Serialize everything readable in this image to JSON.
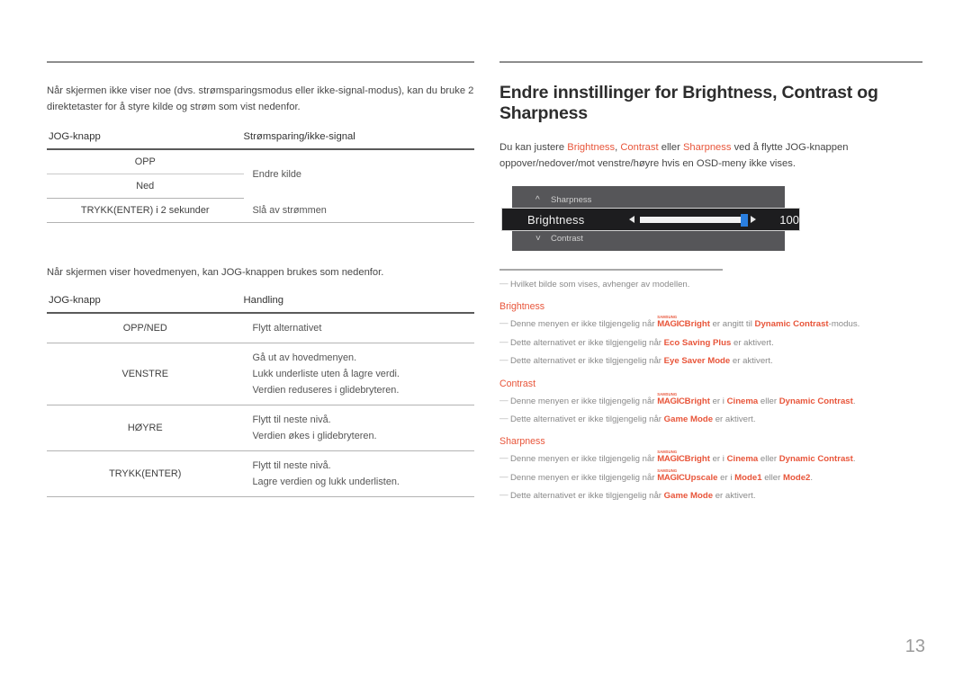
{
  "left": {
    "intro_paragraph": "Når skjermen ikke viser noe (dvs. strømsparingsmodus eller ikke-signal-modus), kan du bruke 2 direktetaster for å styre kilde og strøm som vist nedenfor.",
    "table1": {
      "headers": [
        "JOG-knapp",
        "Strømsparing/ikke-signal"
      ],
      "rows": [
        {
          "key": "OPP",
          "value": "Endre kilde"
        },
        {
          "key": "Ned",
          "value": ""
        },
        {
          "key": "TRYKK(ENTER) i 2 sekunder",
          "value": "Slå av strømmen"
        }
      ]
    },
    "intro_paragraph_2": "Når skjermen viser hovedmenyen, kan JOG-knappen brukes som nedenfor.",
    "table2": {
      "headers": [
        "JOG-knapp",
        "Handling"
      ],
      "rows": [
        {
          "key": "OPP/NED",
          "lines": [
            "Flytt alternativet"
          ]
        },
        {
          "key": "VENSTRE",
          "lines": [
            "Gå ut av hovedmenyen.",
            "Lukk underliste uten å lagre verdi.",
            "Verdien reduseres i glidebryteren."
          ]
        },
        {
          "key": "HØYRE",
          "lines": [
            "Flytt til neste nivå.",
            "Verdien økes i glidebryteren."
          ]
        },
        {
          "key": "TRYKK(ENTER)",
          "lines": [
            "Flytt til neste nivå.",
            "Lagre verdien og lukk underlisten."
          ]
        }
      ]
    }
  },
  "right": {
    "section_title": "Endre innstillinger for Brightness, Contrast og Sharpness",
    "intro": {
      "part1": "Du kan justere ",
      "term1": "Brightness",
      "sep1": ", ",
      "term2": "Contrast",
      "sep2": " eller ",
      "term3": "Sharpness",
      "part2": " ved å flytte JOG-knappen oppover/nedover/mot venstre/høyre hvis en OSD-meny ikke vises."
    },
    "osd": {
      "top_item": "Sharpness",
      "top_chevron": "chevron-up-icon",
      "active_item": "Brightness",
      "value": "100",
      "bottom_item": "Contrast",
      "bottom_chevron": "chevron-down-icon",
      "thumb_color": "#2a7fe0",
      "panel_color": "#565659",
      "active_row_color": "#1d1d1f"
    },
    "notes": {
      "dash": "—",
      "model_note": "Hvilket bilde som vises, avhenger av modellen.",
      "brightness": {
        "heading": "Brightness",
        "items": [
          {
            "pre": "Denne menyen er ikke tilgjengelig når ",
            "magic_sup": "SAMSUNG",
            "magic": "MAGIC",
            "magic_suffix": "Bright",
            "mid": " er angitt til ",
            "term": "Dynamic Contrast",
            "post": "-modus."
          },
          {
            "pre": "Dette alternativet er ikke tilgjengelig når ",
            "term": "Eco Saving Plus",
            "post": " er aktivert."
          },
          {
            "pre": "Dette alternativet er ikke tilgjengelig når ",
            "term": "Eye Saver Mode",
            "post": " er aktivert."
          }
        ]
      },
      "contrast": {
        "heading": "Contrast",
        "items": [
          {
            "pre": "Denne menyen er ikke tilgjengelig når ",
            "magic_sup": "SAMSUNG",
            "magic": "MAGIC",
            "magic_suffix": "Bright",
            "mid": " er i ",
            "term": "Cinema",
            "mid2": " eller ",
            "term2": "Dynamic Contrast",
            "post": "."
          },
          {
            "pre": "Dette alternativet er ikke tilgjengelig når ",
            "term": "Game Mode",
            "post": " er aktivert."
          }
        ]
      },
      "sharpness": {
        "heading": "Sharpness",
        "items": [
          {
            "pre": "Denne menyen er ikke tilgjengelig når ",
            "magic_sup": "SAMSUNG",
            "magic": "MAGIC",
            "magic_suffix": "Bright",
            "mid": " er i ",
            "term": "Cinema",
            "mid2": " eller ",
            "term2": "Dynamic Contrast",
            "post": "."
          },
          {
            "pre": "Denne menyen er ikke tilgjengelig når ",
            "magic_sup": "SAMSUNG",
            "magic": "MAGIC",
            "magic_suffix": "Upscale",
            "mid": " er i ",
            "term": "Mode1",
            "mid2": " eller ",
            "term2": "Mode2",
            "post": "."
          },
          {
            "pre": "Dette alternativet er ikke tilgjengelig når ",
            "term": "Game Mode",
            "post": " er aktivert."
          }
        ]
      }
    }
  },
  "footer": {
    "page_number": "13"
  },
  "colors": {
    "accent": "#e8553a",
    "rule": "#8d8d8d",
    "body_text": "#474747"
  }
}
